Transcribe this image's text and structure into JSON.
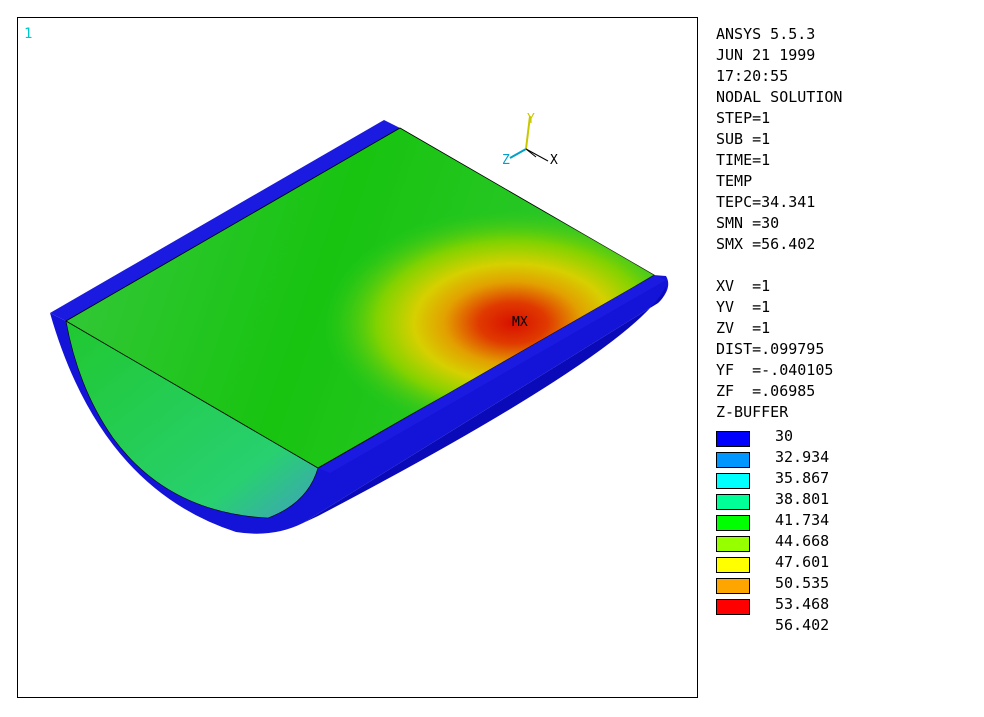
{
  "window_number": "1",
  "triad": {
    "x_label": "X",
    "y_label": "Y",
    "z_label": "Z"
  },
  "max_label": "MX",
  "info_lines": [
    "ANSYS 5.5.3",
    "JUN 21 1999",
    "17:20:55",
    "NODAL SOLUTION",
    "STEP=1",
    "SUB =1",
    "TIME=1",
    "TEMP",
    "TEPC=34.341",
    "SMN =30",
    "SMX =56.402"
  ],
  "view_lines": [
    "XV  =1",
    "YV  =1",
    "ZV  =1",
    "DIST=.099795",
    "YF  =-.040105",
    "ZF  =.06985",
    "Z-BUFFER"
  ],
  "legend": {
    "colors": [
      "#0000ff",
      "#0096ff",
      "#00ffff",
      "#00ff96",
      "#00ff00",
      "#96ff00",
      "#ffff00",
      "#ffa500",
      "#ff0000"
    ],
    "values": [
      "30",
      "32.934",
      "35.867",
      "38.801",
      "41.734",
      "44.668",
      "47.601",
      "50.535",
      "53.468",
      "56.402"
    ]
  }
}
